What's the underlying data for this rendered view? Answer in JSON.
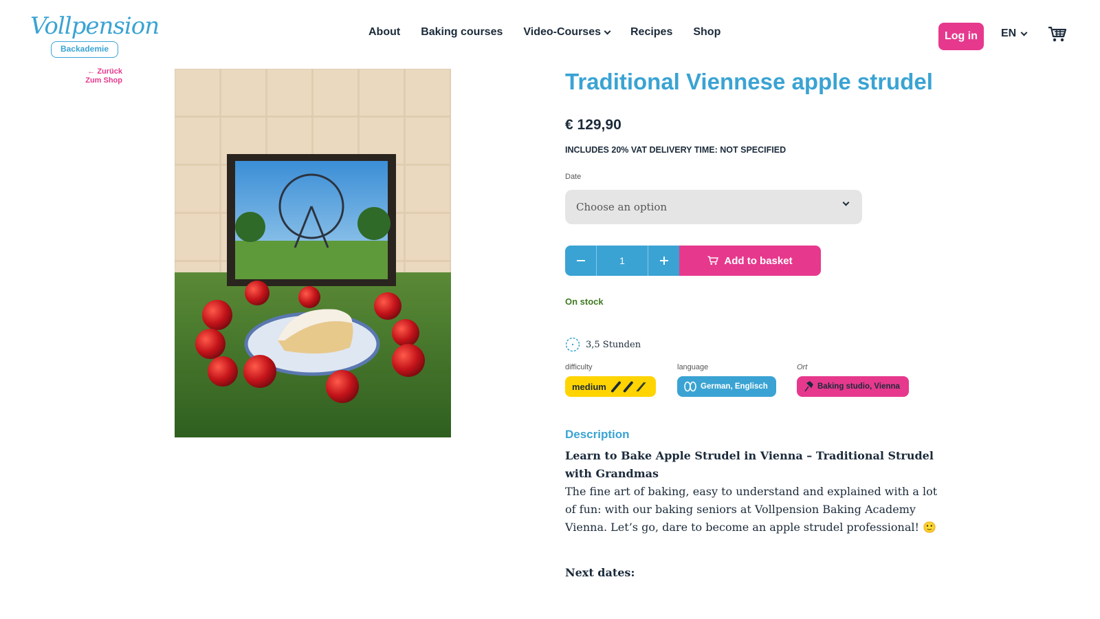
{
  "header": {
    "logo_script": "Vollpension",
    "logo_badge": "Backademie",
    "nav": [
      "About",
      "Baking courses",
      "Video-Courses",
      "Recipes",
      "Shop"
    ],
    "login_label": "Log in",
    "language": "EN",
    "cart_icon": "cart-icon"
  },
  "back_link": {
    "line1": "Zurück",
    "line2": "Zum Shop"
  },
  "product": {
    "title": "Traditional Viennese apple strudel",
    "price": "€ 129,90",
    "vat_note": "INCLUDES 20% VAT  DELIVERY TIME: NOT SPECIFIED",
    "date_label": "Date",
    "date_placeholder": "Choose an option",
    "quantity": "1",
    "add_to_basket": "Add to basket",
    "stock": "On stock",
    "duration": "3,5 Stunden",
    "difficulty_label": "difficulty",
    "difficulty_value": "medium",
    "difficulty_level": 2,
    "difficulty_max": 3,
    "language_label": "language",
    "language_value": "German, Englisch",
    "location_label": "Ort",
    "location_value": "Baking studio, Vienna"
  },
  "description": {
    "heading": "Description",
    "lead": "Learn to Bake Apple Strudel in Vienna – Traditional Strudel with Grandmas",
    "body": "The fine art of baking, easy to understand and explained with a lot of fun: with our baking seniors at Vollpension Baking Academy Vienna. Let’s go, dare to become an apple strudel professional! 🙂",
    "next_dates": "Next dates:"
  },
  "colors": {
    "accent_blue": "#3aa3d3",
    "accent_pink": "#e6398d",
    "accent_yellow": "#ffd400",
    "stock_green": "#3f7a22"
  }
}
